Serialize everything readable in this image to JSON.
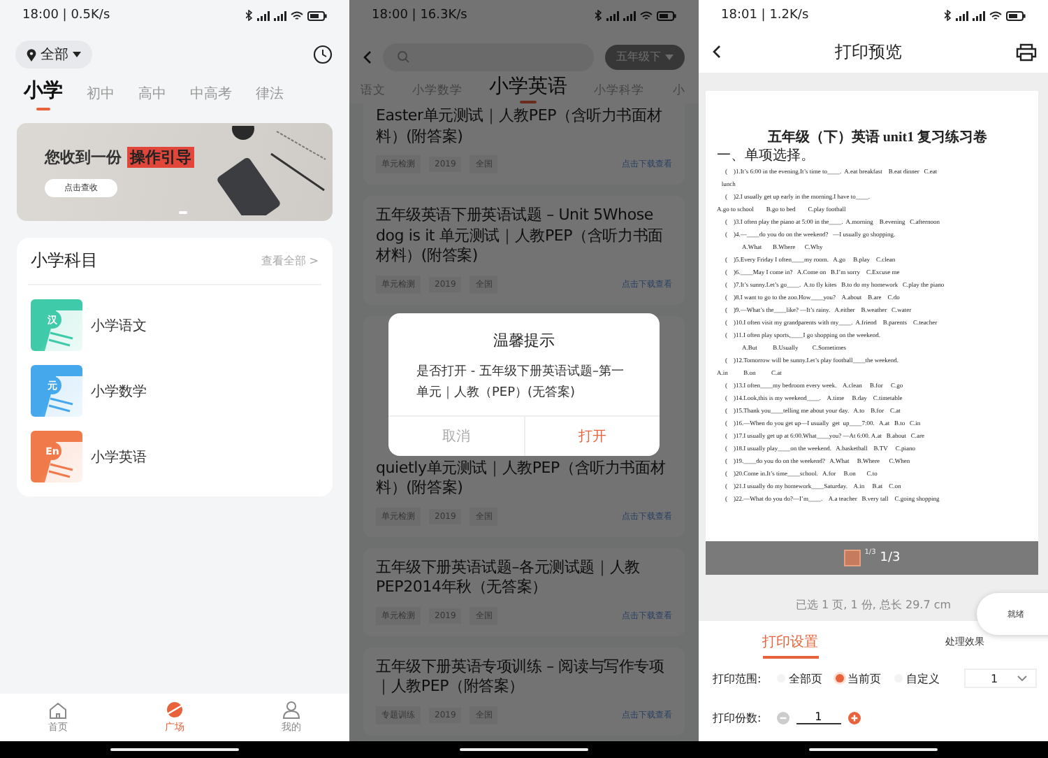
{
  "home_screen": {
    "status_bar": {
      "time": "18:00 | 0.5K/s"
    },
    "location": {
      "label": "全部"
    },
    "tabs": [
      {
        "label": "小学",
        "selected": true
      },
      {
        "label": "初中",
        "selected": false
      },
      {
        "label": "高中",
        "selected": false
      },
      {
        "label": "中高考",
        "selected": false
      },
      {
        "label": "律法",
        "selected": false
      }
    ],
    "banner": {
      "headline": "您收到一份",
      "highlight": "操作引导",
      "button": "点击查收"
    },
    "subjects": {
      "title": "小学科目",
      "more": "查看全部 >",
      "items": [
        {
          "name": "小学语文",
          "badge": "汉",
          "color": "#3fcaa9"
        },
        {
          "name": "小学数学",
          "badge": "元",
          "color": "#45a8ec"
        },
        {
          "name": "小学英语",
          "badge": "En",
          "color": "#f07a4a"
        }
      ]
    },
    "nav": [
      {
        "label": "首页",
        "kind": "home",
        "selected": false
      },
      {
        "label": "广场",
        "kind": "planet",
        "selected": true
      },
      {
        "label": "我的",
        "kind": "person",
        "selected": false
      }
    ]
  },
  "list_screen": {
    "status_bar": {
      "time": "18:00 | 16.3K/s"
    },
    "grade": "五年级下",
    "tabs": [
      {
        "label": "语文",
        "selected": false
      },
      {
        "label": "小学数学",
        "selected": false
      },
      {
        "label": "小学英语",
        "selected": true
      },
      {
        "label": "小学科学",
        "selected": false
      },
      {
        "label": "小",
        "selected": false
      }
    ],
    "items": [
      {
        "title": "Easter单元测试｜人教PEP（含听力书面材料）(附答案)",
        "tags": [
          "单元检测",
          "2019",
          "全国"
        ],
        "action": "点击下载查看",
        "clipped_top": false
      },
      {
        "title": "五年级英语下册英语试题 – Unit 5Whose dog is it 单元测试｜人教PEP（含听力书面材料）(附答案)",
        "tags": [
          "单元检测",
          "2019",
          "全国"
        ],
        "action": "点击下载查看",
        "clipped_top": false
      },
      {
        "title": "quietly单元测试｜人教PEP（含听力书面材料）(附答案)",
        "tags": [
          "单元检测",
          "2019",
          "全国"
        ],
        "action": "点击下载查看",
        "clipped_top": true
      },
      {
        "title": "五年级下册英语试题–各元测试题｜人教PEP2014年秋（无答案）",
        "tags": [
          "单元检测",
          "2019",
          "全国"
        ],
        "action": "点击下载查看",
        "clipped_top": false
      },
      {
        "title": "五年级下册英语专项训练 – 阅读与写作专项｜人教PEP（附答案）",
        "tags": [
          "专题训练",
          "2019",
          "全国"
        ],
        "action": "点击下载查看",
        "clipped_top": false
      }
    ],
    "dialog": {
      "title": "温馨提示",
      "message": "是否打开 - 五年级下册英语试题–第一单元｜人教（PEP）(无答案)",
      "buttons": [
        {
          "label": "取消",
          "kind": "cancel"
        },
        {
          "label": "打开",
          "kind": "confirm"
        }
      ]
    }
  },
  "print_screen": {
    "status_bar": {
      "time": "18:01 | 1.2K/s"
    },
    "title": "打印预览",
    "document": {
      "title": "五年级（下）英语 unit1 复习练习卷",
      "lines": [
        {
          "kind": "heading",
          "text": "一、单项选择。"
        },
        {
          "kind": "question",
          "text": "(    )1.It’s 6:00 in the evening.It’s time to____.  A.eat breakfast    B.eat dinner   C.eat"
        },
        {
          "kind": "wrap",
          "text": "   lunch"
        },
        {
          "kind": "question",
          "text": "(    )2.I usually get up early in the morning.I have to____."
        },
        {
          "kind": "wrap",
          "text": "A.go to school        B.go to bed        C.play football"
        },
        {
          "kind": "question",
          "text": "(    )3.I often play the piano at 5:00 in the____.  A.morning    B.evening   C.afternoon"
        },
        {
          "kind": "question",
          "text": "(    )4.—____do you do on the weekend?   —I usually go shopping."
        },
        {
          "kind": "options",
          "text": "A.What       B.Where      C.Why"
        },
        {
          "kind": "question",
          "text": "(    )5.Every Friday I often____my room.   A.go     B.play    C.clean"
        },
        {
          "kind": "question",
          "text": "(    )6.____May I come in?   A.Come on   B.I’m sorry    C.Excuse me"
        },
        {
          "kind": "question",
          "text": "(    )7.It’s sunny.Let’s go____.  A.to fly kites   B.to do my homework   C.play the piano"
        },
        {
          "kind": "question",
          "text": "(    )8.I want to go to the zoo.How____you?    A.about    B.are    C.do"
        },
        {
          "kind": "question",
          "text": "(    )9.—What’s the____like? —It’s rainy.   A.either    B.weather   C.water"
        },
        {
          "kind": "question",
          "text": "(    )10.I often visit my grandparents with my____.  A.friend    B.parents    C.teacher"
        },
        {
          "kind": "question",
          "text": "(    )11.I often play sports,____I go shopping on the weekend."
        },
        {
          "kind": "options",
          "text": "A.But          B.Usually         C.Sometimes"
        },
        {
          "kind": "question",
          "text": "(    )12.Tomorrow will be sunny.Let’s play football____the weekend."
        },
        {
          "kind": "wrap",
          "text": "A.in          B.on          C.at"
        },
        {
          "kind": "question",
          "text": "(    )13.I often____my bedroom every week.    A.clean     B.for     C.go"
        },
        {
          "kind": "question",
          "text": "(    )14.Look,this is my weekend____.    A.time     B.day    C.timetable"
        },
        {
          "kind": "question",
          "text": "(    )15.Thank you____telling me about your day.   A.to    B.for    C.at"
        },
        {
          "kind": "question",
          "text": "(    )16.—When do you get up—I usually  get  up____7:00.   A.at   B.to   C.in"
        },
        {
          "kind": "question",
          "text": "(    )17.I usually get up at 6:00.What____you? —At 6:00. A.at   B.about   C.are"
        },
        {
          "kind": "question",
          "text": "(    )18.I usually play____on the weekend.   A.basketball    B.TV     C.piano"
        },
        {
          "kind": "question",
          "text": "(    )19.____do you do on the weekend?   A.What     B.Where      C.When"
        },
        {
          "kind": "question",
          "text": "(    )20.Come in.It’s time____school.   A.for     B.on       C.to"
        },
        {
          "kind": "question",
          "text": "(    )21.I usually do my homework____Saturday.    A.in     B.at    C.on"
        },
        {
          "kind": "question",
          "text": "(    )22.—What do you do?—I’m____.    A.a teacher   B.very tall    C.going shopping"
        }
      ]
    },
    "pager": {
      "thumb_label": "1/3",
      "page": "1/3"
    },
    "status_chip": "就绪",
    "summary": "已选 1 页, 1 份, 总长 29.7 cm",
    "tabs": [
      {
        "label": "打印设置",
        "selected": true
      },
      {
        "label": "处理效果",
        "selected": false
      }
    ],
    "range": {
      "label": "打印范围:",
      "options": [
        {
          "label": "全部页",
          "selected": false
        },
        {
          "label": "当前页",
          "selected": true
        },
        {
          "label": "自定义",
          "selected": false
        }
      ],
      "custom_value": "1"
    },
    "copies": {
      "label": "打印份数:",
      "value": "1"
    }
  }
}
